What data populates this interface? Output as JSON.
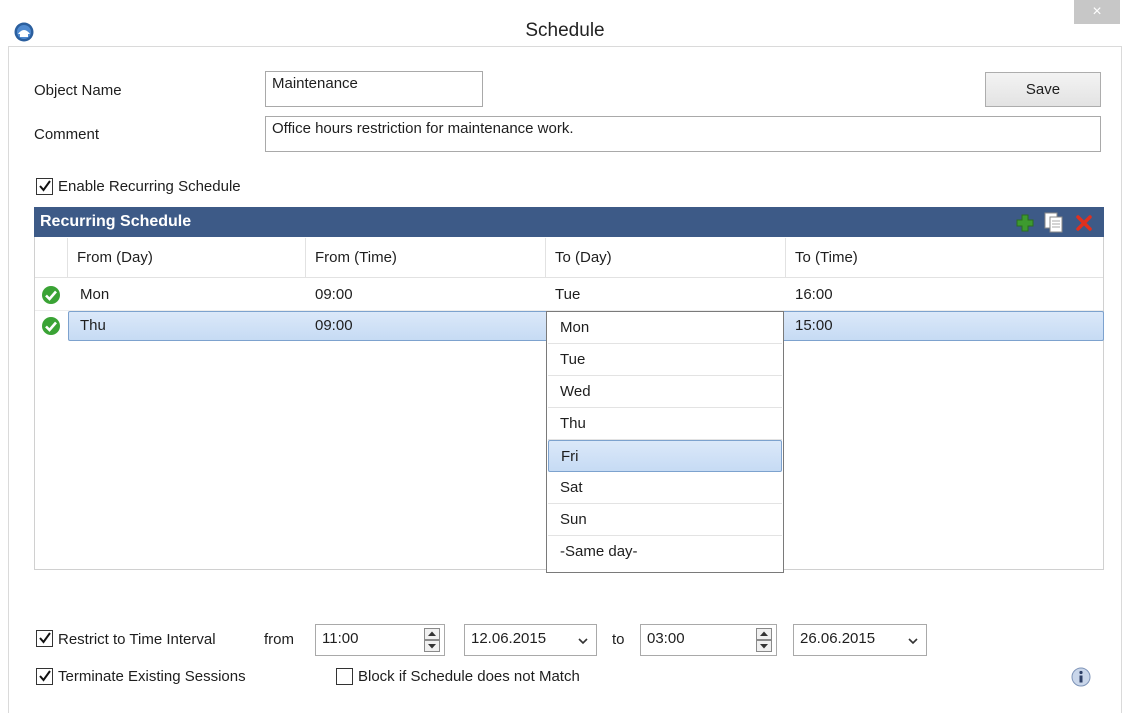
{
  "window": {
    "title": "Schedule",
    "close_glyph": "×"
  },
  "form": {
    "object_name_label": "Object Name",
    "object_name_value": "Maintenance",
    "comment_label": "Comment",
    "comment_value": "Office hours restriction for maintenance work.",
    "save_label": "Save",
    "enable_recurring_label": "Enable Recurring Schedule",
    "enable_recurring_checked": true
  },
  "grid": {
    "title": "Recurring Schedule",
    "toolbar_icons": [
      "add-icon",
      "copy-icon",
      "delete-icon"
    ],
    "columns": [
      "From (Day)",
      "From (Time)",
      "To (Day)",
      "To (Time)"
    ],
    "rows": [
      {
        "from_day": "Mon",
        "from_time": "09:00",
        "to_day": "Tue",
        "to_time": "16:00",
        "status": "valid",
        "selected": false
      },
      {
        "from_day": "Thu",
        "from_time": "09:00",
        "to_day": "Fri",
        "to_time": "15:00",
        "status": "valid",
        "selected": true
      }
    ]
  },
  "dropdown": {
    "options": [
      "Mon",
      "Tue",
      "Wed",
      "Thu",
      "Fri",
      "Sat",
      "Sun",
      "-Same day-"
    ],
    "highlighted": "Fri"
  },
  "restrict": {
    "label": "Restrict to Time Interval",
    "checked": true,
    "from_label": "from",
    "from_time": "11:00",
    "from_date": "12.06.2015",
    "to_label": "to",
    "to_time": "03:00",
    "to_date": "26.06.2015"
  },
  "options": {
    "terminate_label": "Terminate Existing Sessions",
    "terminate_checked": true,
    "block_label": "Block if Schedule does not Match",
    "block_checked": false
  },
  "colors": {
    "grid_header": "#3d5a87",
    "selection": "#c6dbf4",
    "valid_check": "#3aa335",
    "delete_red": "#e0301e",
    "add_green": "#3d9a2f"
  }
}
